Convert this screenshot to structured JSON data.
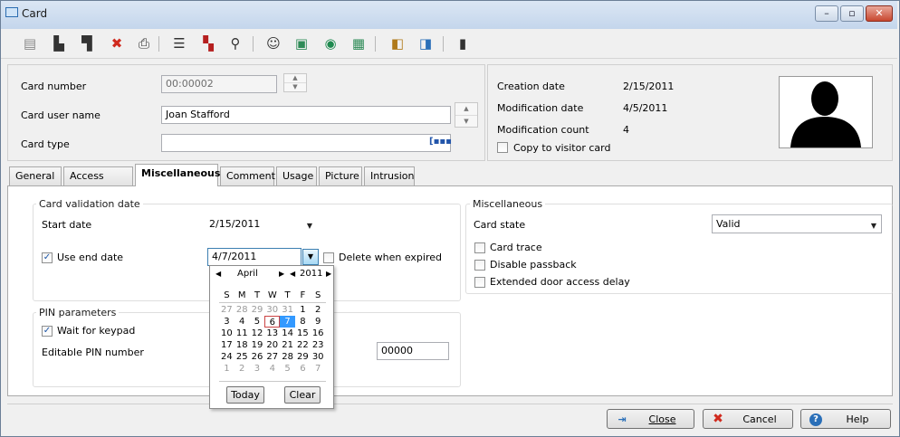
{
  "window": {
    "title": "Card",
    "controls": {
      "minimize": "–",
      "maximize": "▫",
      "close": "✕"
    }
  },
  "toolbar": {
    "items": [
      "new-icon",
      "save-icon",
      "save-close-icon",
      "delete-icon",
      "print-icon",
      "list-icon",
      "filter-icon",
      "search-icon",
      "users-icon",
      "card-icon",
      "access-icon",
      "badge-icon",
      "export-icon",
      "import-icon",
      "exit-icon"
    ]
  },
  "card": {
    "number_label": "Card number",
    "number_value": "00:00002",
    "user_label": "Card user name",
    "user_value": "Joan Stafford",
    "type_label": "Card type",
    "type_value": ""
  },
  "info": {
    "creation_label": "Creation date",
    "creation_value": "2/15/2011",
    "modification_label": "Modification date",
    "modification_value": "4/5/2011",
    "count_label": "Modification count",
    "count_value": "4",
    "copy_label": "Copy to visitor card"
  },
  "tabs": [
    "General",
    "Access level",
    "Miscellaneous",
    "Comment",
    "Usage",
    "Picture",
    "Intrusion"
  ],
  "validation": {
    "group_label": "Card validation date",
    "start_label": "Start date",
    "start_value": "2/15/2011",
    "use_end_label": "Use end date",
    "end_value": "4/7/2011",
    "delete_label": "Delete when expired"
  },
  "calendar": {
    "month": "April",
    "year": "2011",
    "days": [
      "S",
      "M",
      "T",
      "W",
      "T",
      "F",
      "S"
    ],
    "weeks": [
      [
        "27",
        "28",
        "29",
        "30",
        "31",
        "1",
        "2"
      ],
      [
        "3",
        "4",
        "5",
        "6",
        "7",
        "8",
        "9"
      ],
      [
        "10",
        "11",
        "12",
        "13",
        "14",
        "15",
        "16"
      ],
      [
        "17",
        "18",
        "19",
        "20",
        "21",
        "22",
        "23"
      ],
      [
        "24",
        "25",
        "26",
        "27",
        "28",
        "29",
        "30"
      ],
      [
        "1",
        "2",
        "3",
        "4",
        "5",
        "6",
        "7"
      ]
    ],
    "today_label": "Today",
    "clear_label": "Clear"
  },
  "pin": {
    "group_label": "PIN parameters",
    "wait_label": "Wait for keypad",
    "editable_label": "Editable PIN number",
    "pin_value": "00000"
  },
  "misc": {
    "group_label": "Miscellaneous",
    "state_label": "Card state",
    "state_value": "Valid",
    "trace_label": "Card trace",
    "passback_label": "Disable passback",
    "delay_label": "Extended door access delay"
  },
  "footer": {
    "close_label": "Close",
    "cancel_label": "Cancel",
    "help_label": "Help"
  }
}
